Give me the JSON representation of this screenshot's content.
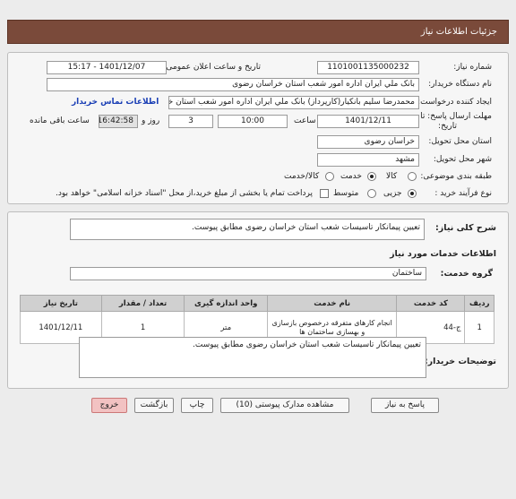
{
  "header": {
    "title": "جزئیات اطلاعات نیاز"
  },
  "form": {
    "need_number_label": "شماره نیاز:",
    "need_number_value": "1101001135000232",
    "announce_label": "تاریخ و ساعت اعلان عمومی:",
    "announce_value": "1401/12/07 - 15:17",
    "buyer_org_label": "نام دستگاه خریدار:",
    "buyer_org_value": "بانک ملي ايران اداره امور شعب استان خراسان رضوی",
    "creator_label": "ایجاد کننده درخواست:",
    "creator_value": "محمدرضا سليم  بانکيار(کارپرداز) بانک ملي ايران اداره امور شعب استان خراسان ر",
    "contact_link": "اطلاعات تماس خریدار",
    "deadline_label_1": "مهلت ارسال پاسخ: تا",
    "deadline_label_2": "تاریخ:",
    "deadline_date": "1401/12/11",
    "time_label": "ساعت",
    "deadline_time": "10:00",
    "days_value": "3",
    "days_label": "روز و",
    "remaining_time": "16:42:58",
    "remaining_label": "ساعت باقی مانده",
    "province_label": "استان محل تحویل:",
    "province_value": "خراسان رضوی",
    "city_label": "شهر محل تحویل:",
    "city_value": "مشهد",
    "category_label": "طبقه بندی موضوعی:",
    "category_options": [
      "کالا",
      "خدمت",
      "کالا/خدمت"
    ],
    "process_label": "نوع فرآیند خرید :",
    "process_options": [
      "جزیی",
      "متوسط"
    ],
    "payment_note": "پرداخت تمام یا بخشی از مبلغ خرید،از محل \"اسناد خزانه اسلامی\" خواهد بود."
  },
  "description": {
    "label": "شرح کلی نیاز:",
    "value": "تعیین پیمانکار تاسیسات شعب استان خراسان رضوی مطابق پیوست."
  },
  "services": {
    "section_title": "اطلاعات خدمات مورد نیاز",
    "group_label": "گروه خدمت:",
    "group_value": "ساختمان",
    "columns": [
      "ردیف",
      "کد خدمت",
      "نام خدمت",
      "واحد اندازه گیری",
      "تعداد / مقدار",
      "تاریخ نیاز"
    ],
    "rows": [
      {
        "row": "1",
        "code": "ج-44",
        "name": "انجام کارهای متفرقه درخصوص بازسازی و بهسازی ساختمان ها",
        "unit": "متر",
        "qty": "1",
        "date": "1401/12/11"
      }
    ]
  },
  "buyer_notes": {
    "label": "توضیحات خریدار:",
    "value": "تعیین پیمانکار تاسیسات شعب استان خراسان رضوی مطابق پیوست."
  },
  "buttons": {
    "reply": "پاسخ به نیاز",
    "docs": "مشاهده مدارک پیوستی (10)",
    "print": "چاپ",
    "back": "بازگشت",
    "exit": "خروج"
  }
}
